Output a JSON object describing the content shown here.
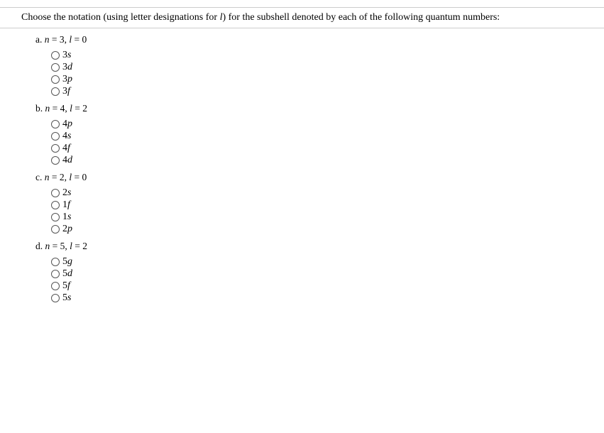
{
  "header": {
    "prefix": "Choose the notation (using letter designations for ",
    "lvar": "l",
    "suffix": ") for the subshell denoted by each of the following quantum numbers:"
  },
  "parts": [
    {
      "letter": "a.",
      "nvar": "n",
      "nval": "3",
      "lvar": "l",
      "lval": "0",
      "opts": [
        {
          "num": "3",
          "orb": "s"
        },
        {
          "num": "3",
          "orb": "d"
        },
        {
          "num": "3",
          "orb": "p"
        },
        {
          "num": "3",
          "orb": "f"
        }
      ]
    },
    {
      "letter": "b.",
      "nvar": "n",
      "nval": "4",
      "lvar": "l",
      "lval": "2",
      "opts": [
        {
          "num": "4",
          "orb": "p"
        },
        {
          "num": "4",
          "orb": "s"
        },
        {
          "num": "4",
          "orb": "f"
        },
        {
          "num": "4",
          "orb": "d"
        }
      ]
    },
    {
      "letter": "c.",
      "nvar": "n",
      "nval": "2",
      "lvar": "l",
      "lval": "0",
      "opts": [
        {
          "num": "2",
          "orb": "s"
        },
        {
          "num": "1",
          "orb": "f"
        },
        {
          "num": "1",
          "orb": "s"
        },
        {
          "num": "2",
          "orb": "p"
        }
      ]
    },
    {
      "letter": "d.",
      "nvar": "n",
      "nval": "5",
      "lvar": "l",
      "lval": "2",
      "opts": [
        {
          "num": "5",
          "orb": "g"
        },
        {
          "num": "5",
          "orb": "d"
        },
        {
          "num": "5",
          "orb": "f"
        },
        {
          "num": "5",
          "orb": "s"
        }
      ]
    }
  ]
}
